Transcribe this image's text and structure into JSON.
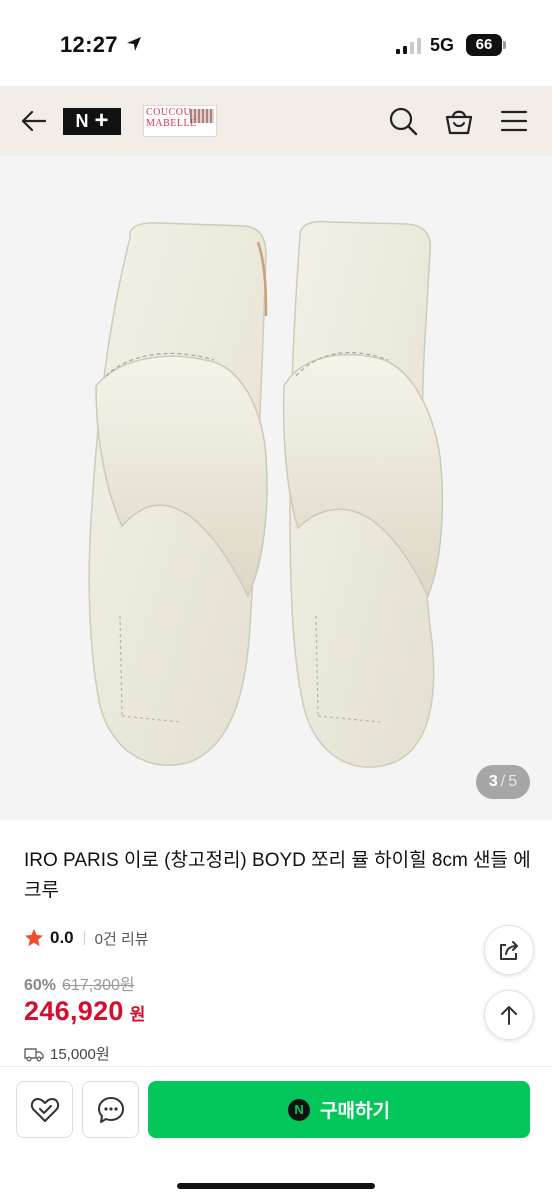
{
  "status_bar": {
    "time": "12:27",
    "network": "5G",
    "battery": "66"
  },
  "header": {
    "brand_logo_text": "N+",
    "store_logo_line1": "COUCOU",
    "store_logo_line2": "MABELLE"
  },
  "gallery": {
    "current": "3",
    "separator": "/",
    "total": "5",
    "background_color": "#f4f4f4"
  },
  "product": {
    "title": "IRO PARIS 이로 (창고정리) BOYD 쪼리 뮬 하이힐 8cm 샌들 에크루",
    "rating": "0.0",
    "review_count": "0건 리뷰",
    "discount_rate": "60%",
    "original_price": "617,300원",
    "sale_price": "246,920",
    "price_unit": "원",
    "shipping_fee": "15,000원"
  },
  "actions": {
    "buy_label": "구매하기",
    "npay_badge": "N"
  },
  "colors": {
    "accent_green": "#03c75a",
    "price_red": "#d20f2e",
    "header_bg": "#f3ede8",
    "star": "#f04e2a"
  },
  "icons": [
    "back-arrow-icon",
    "search-icon",
    "shopping-bag-icon",
    "menu-icon",
    "star-icon",
    "truck-icon",
    "share-icon",
    "arrow-up-icon",
    "heart-check-icon",
    "chat-icon"
  ]
}
